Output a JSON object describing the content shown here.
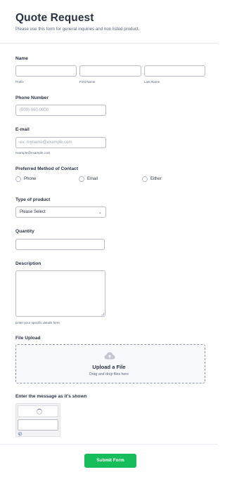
{
  "form": {
    "title": "Quote Request",
    "subtitle": "Please use this form for general inquiries and non listed product."
  },
  "name": {
    "label": "Name",
    "sublabels": [
      "Prefix",
      "First Name",
      "Last Name"
    ]
  },
  "phone": {
    "label": "Phone Number",
    "placeholder": "(000) 000-0000"
  },
  "email": {
    "label": "E-mail",
    "placeholder": "ex: myname@example.com",
    "hint": "example@example.com"
  },
  "contact": {
    "label": "Preferred Method of Contact",
    "options": [
      "Phone",
      "Email",
      "Either"
    ]
  },
  "product": {
    "label": "Type of product",
    "selected": "Please Select"
  },
  "quantity": {
    "label": "Quantity"
  },
  "description": {
    "label": "Description",
    "hint": "Enter your specific details here"
  },
  "upload": {
    "label": "File Upload",
    "title": "Upload a File",
    "subtitle": "Drag and drop files here"
  },
  "captcha": {
    "label": "Enter the message as it's shown"
  },
  "submit": {
    "label": "Submit Form",
    "color": "#18bd5b"
  }
}
